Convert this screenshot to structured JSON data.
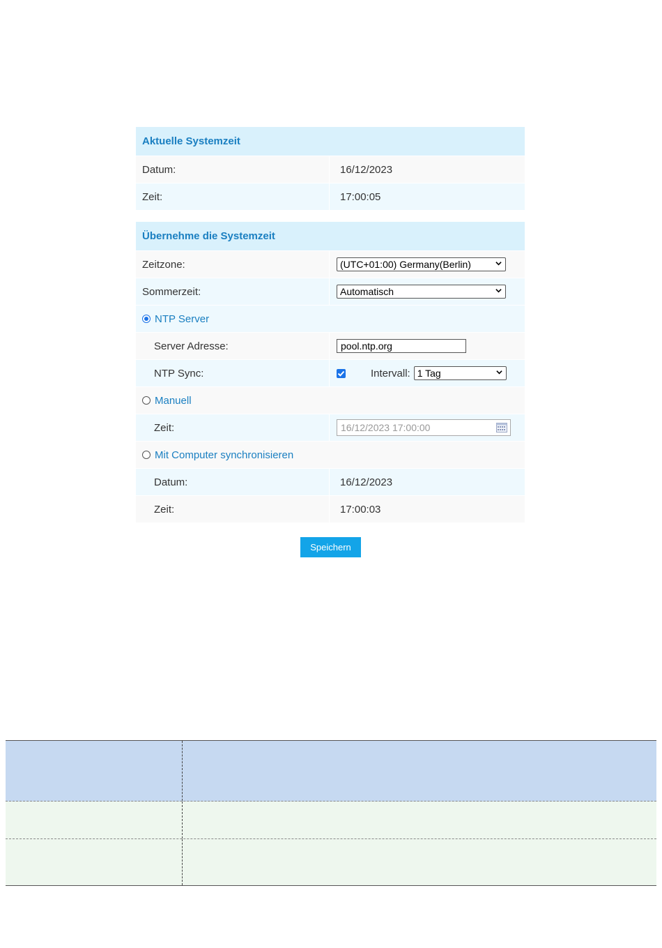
{
  "current_time": {
    "header": "Aktuelle Systemzeit",
    "date_label": "Datum:",
    "date_value": "16/12/2023",
    "time_label": "Zeit:",
    "time_value": "17:00:05"
  },
  "apply_time": {
    "header": "Übernehme die Systemzeit",
    "timezone_label": "Zeitzone:",
    "timezone_value": "(UTC+01:00) Germany(Berlin)",
    "dst_label": "Sommerzeit:",
    "dst_value": "Automatisch",
    "ntp": {
      "option_label": "NTP Server",
      "selected": true,
      "server_label": "Server Adresse:",
      "server_value": "pool.ntp.org",
      "sync_label": "NTP Sync:",
      "sync_checked": true,
      "interval_label": "Intervall:",
      "interval_value": "1 Tag"
    },
    "manual": {
      "option_label": "Manuell",
      "time_label": "Zeit:",
      "time_placeholder": "16/12/2023 17:00:00"
    },
    "computer_sync": {
      "option_label": "Mit Computer synchronisieren",
      "date_label": "Datum:",
      "date_value": "16/12/2023",
      "time_label": "Zeit:",
      "time_value": "17:00:03"
    }
  },
  "save_label": "Speichern",
  "colors": {
    "header_bg": "#d9f1fc",
    "header_text": "#1a7fc1",
    "button_bg": "#13a4e8",
    "table_head_bg": "#c6d9f1",
    "table_body_bg": "#eef7ee"
  }
}
